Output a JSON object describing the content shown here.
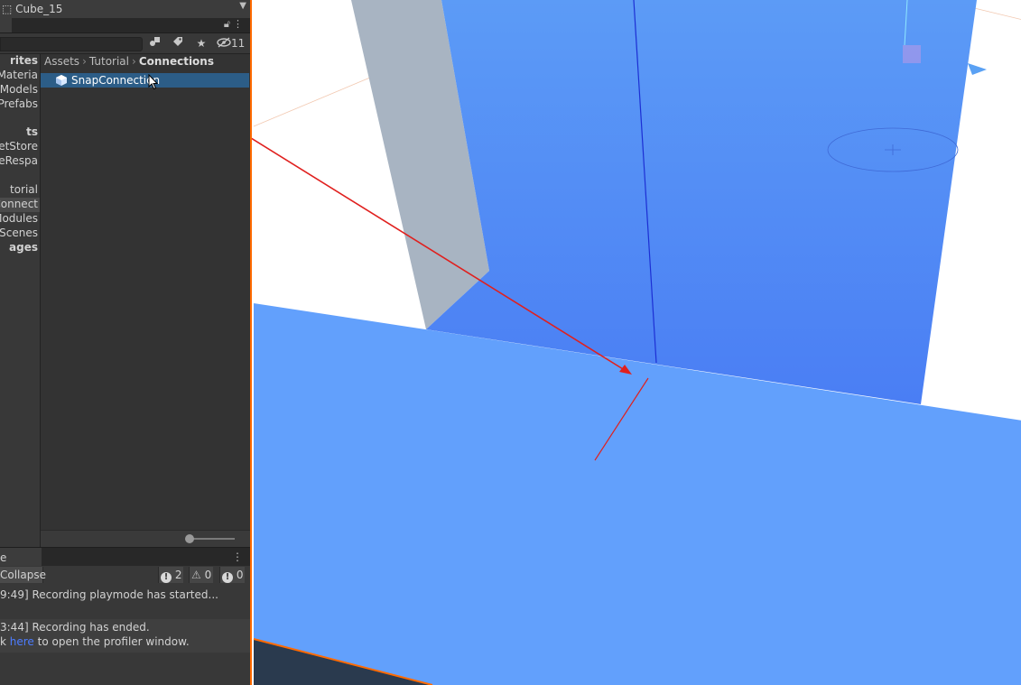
{
  "top_strip": {
    "object_name": "Cube_15"
  },
  "project": {
    "hidden_count": "11",
    "favorites": [
      {
        "label": "rites",
        "bold": true
      },
      {
        "label": "Materia",
        "bold": false
      },
      {
        "label": "Models",
        "bold": false
      },
      {
        "label": "Prefabs",
        "bold": false
      },
      {
        "label": "ts",
        "bold": true
      },
      {
        "label": "setStore",
        "bold": false
      },
      {
        "label": "deRespa",
        "bold": false
      },
      {
        "label": "torial",
        "bold": false
      },
      {
        "label": "Connect",
        "bold": false,
        "selected": true
      },
      {
        "label": "Modules",
        "bold": false
      },
      {
        "label": "Scenes",
        "bold": false
      },
      {
        "label": "ages",
        "bold": true
      }
    ],
    "breadcrumb": [
      "Assets",
      "Tutorial",
      "Connections"
    ],
    "asset": {
      "name": "SnapConnection"
    }
  },
  "console": {
    "tab_label": "e",
    "collapse_label": "Collapse",
    "counts": {
      "log": "2",
      "warning": "0",
      "error": "0"
    },
    "logs": {
      "row1": "9:49] Recording playmode has started...",
      "row2_line1": "3:44] Recording has ended.",
      "row2_prefix": "k ",
      "row2_link": "here",
      "row2_suffix": " to open the profiler window."
    }
  },
  "colors": {
    "selection": "#2c5d87",
    "scene_highlight": "#ff6a00",
    "plane_blue": "#62a0fc",
    "wall_blue": "#5288f6",
    "annotation_red": "#e0201e",
    "link": "#4c7cff"
  },
  "icons": [
    "lock-icon",
    "kebab-icon",
    "search-icon",
    "filter-type-icon",
    "label-icon",
    "favorite-star-icon",
    "eye-slash-icon",
    "prefab-cube-icon",
    "mouse-cursor-icon",
    "info-icon",
    "warning-icon",
    "error-icon"
  ]
}
